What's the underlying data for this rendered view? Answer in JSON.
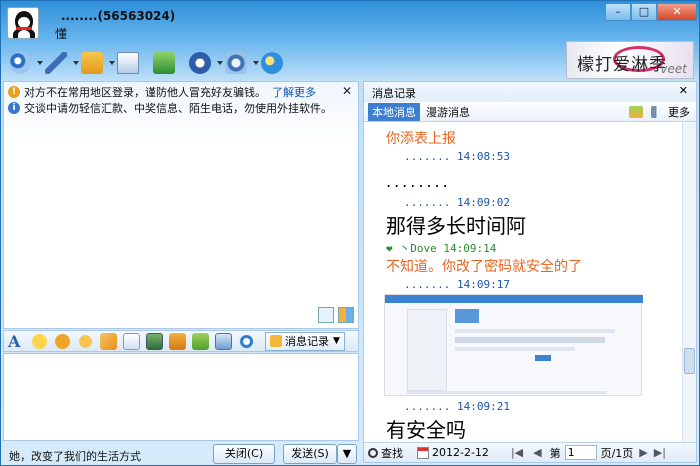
{
  "title": {
    "nickname": "........(56563024)",
    "signature": "懂"
  },
  "window_controls": [
    "–",
    "□",
    "✕"
  ],
  "toolbar": {
    "items": [
      "video-call-icon",
      "voice-call-icon",
      "file-transfer-icon",
      "send-email-icon",
      "remote-assist-icon",
      "app-center-icon",
      "settings-icon",
      "qq-app-icon"
    ]
  },
  "ad": {
    "text": "檬打爱淋季",
    "sub": "veet"
  },
  "notices": [
    {
      "text": "对方不在常用地区登录，谨防他人冒充好友骗钱。",
      "link": "了解更多"
    },
    {
      "text": "交谈中请勿轻信汇款、中奖信息、陌生电话，勿使用外挂软件。"
    }
  ],
  "format_bar": {
    "font": "A",
    "msglog": "消息记录"
  },
  "status_text": "她，改变了我们的生活方式",
  "buttons": {
    "close": "关闭(C)",
    "send": "发送(S)"
  },
  "history": {
    "title": "消息记录",
    "tab_local": "本地消息",
    "tab_roam": "漫游消息",
    "more": "更多",
    "messages": [
      {
        "stamp": "....... 14:08:53",
        "text": "你添表上报"
      },
      {
        "stamp": "....... 14:09:02",
        "text": "........"
      },
      {
        "stamp": "",
        "text": "那得多长时间阿"
      },
      {
        "stamp": "❤ 丶Dove 14:09:14",
        "text": "不知道。你改了密码就安全的了"
      },
      {
        "stamp": "....... 14:09:17",
        "text": ""
      },
      {
        "stamp": "....... 14:09:21",
        "text": "有安全吗"
      }
    ],
    "footer": {
      "search": "查找",
      "date": "2012-2-12",
      "page_prefix": "第",
      "page": "1",
      "page_suffix": "页/1页"
    }
  }
}
